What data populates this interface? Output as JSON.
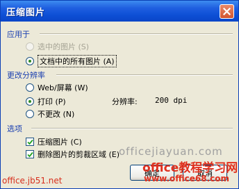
{
  "window": {
    "title": "压缩图片"
  },
  "apply_to": {
    "label": "应用于",
    "options": [
      {
        "label": "选中的图片 (S)",
        "checked": false,
        "disabled": true
      },
      {
        "label": "文档中的所有图片 (A)",
        "checked": true,
        "disabled": false
      }
    ]
  },
  "resolution": {
    "label": "更改分辨率",
    "options": [
      {
        "label": "Web/屏幕 (W)",
        "checked": false
      },
      {
        "label": "打印 (P)",
        "checked": true
      },
      {
        "label": "不更改 (N)",
        "checked": false
      }
    ],
    "resolution_label": "分辨率:",
    "resolution_value": "200 dpi"
  },
  "options": {
    "label": "选项",
    "items": [
      {
        "label": "压缩图片 (C)",
        "checked": true
      },
      {
        "label": "删除图片的剪裁区域 (E)",
        "checked": true
      }
    ]
  },
  "buttons": {
    "ok": "确定",
    "cancel": "取消"
  },
  "watermarks": {
    "site1": "officejiayuan.com",
    "site2_cn": "office教程学习网",
    "site2_url": "www.office68.com",
    "site3": "office.jb51.net"
  },
  "colors": {
    "title_bar": "#0a46c8",
    "group_label": "#1a3fb0",
    "watermark_red": "#e0301e"
  }
}
